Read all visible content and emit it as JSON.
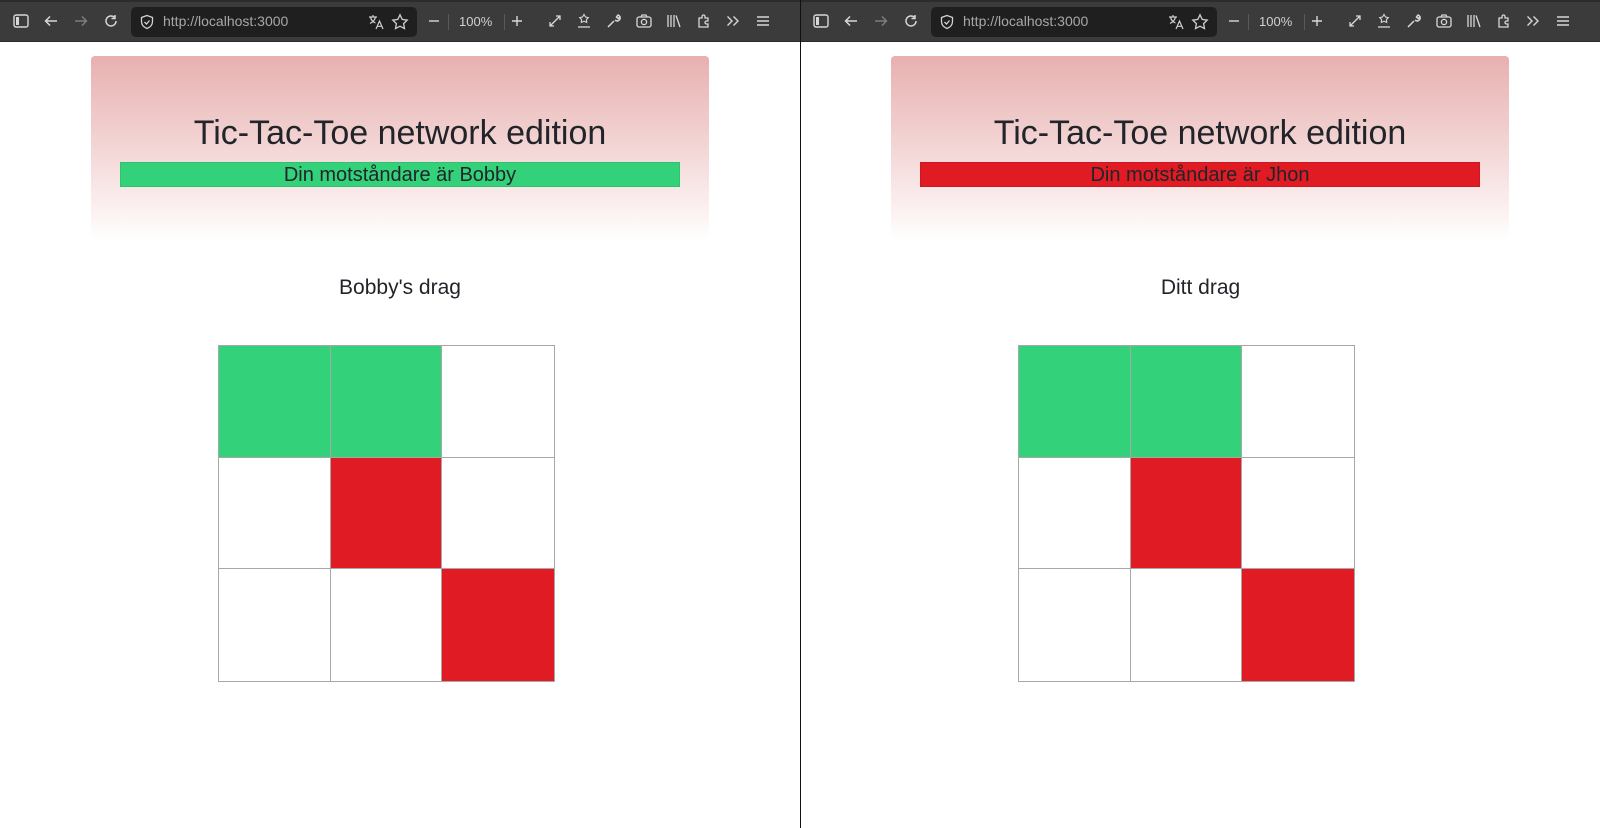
{
  "windows": [
    {
      "id": "left",
      "browser": {
        "url": "http://localhost:3000",
        "zoom": "100%"
      },
      "page": {
        "title": "Tic-Tac-Toe network edition",
        "opponent_text": "Din motståndare är Bobby",
        "opponent_bar_color": "#33d17a",
        "turn_text": "Bobby's drag",
        "board": [
          "#33d17a",
          "#33d17a",
          "#ffffff",
          "#ffffff",
          "#e01b24",
          "#ffffff",
          "#ffffff",
          "#ffffff",
          "#e01b24"
        ]
      }
    },
    {
      "id": "right",
      "browser": {
        "url": "http://localhost:3000",
        "zoom": "100%"
      },
      "page": {
        "title": "Tic-Tac-Toe network edition",
        "opponent_text": "Din motståndare är Jhon",
        "opponent_bar_color": "#e01b24",
        "turn_text": "Ditt drag",
        "board": [
          "#33d17a",
          "#33d17a",
          "#ffffff",
          "#ffffff",
          "#e01b24",
          "#ffffff",
          "#ffffff",
          "#ffffff",
          "#e01b24"
        ]
      }
    }
  ],
  "colors": {
    "green": "#33d17a",
    "red": "#e01b24",
    "empty": "#ffffff"
  },
  "icons": [
    "sidebar-icon",
    "back-arrow-icon",
    "forward-arrow-icon",
    "reload-icon",
    "shield-icon",
    "translate-icon",
    "star-icon",
    "zoom-out-icon",
    "zoom-in-icon",
    "fullscreen-icon",
    "reader-icon",
    "wrench-icon",
    "camera-icon",
    "library-icon",
    "extension-icon",
    "overflow-chevron-icon",
    "menu-hamburger-icon"
  ]
}
